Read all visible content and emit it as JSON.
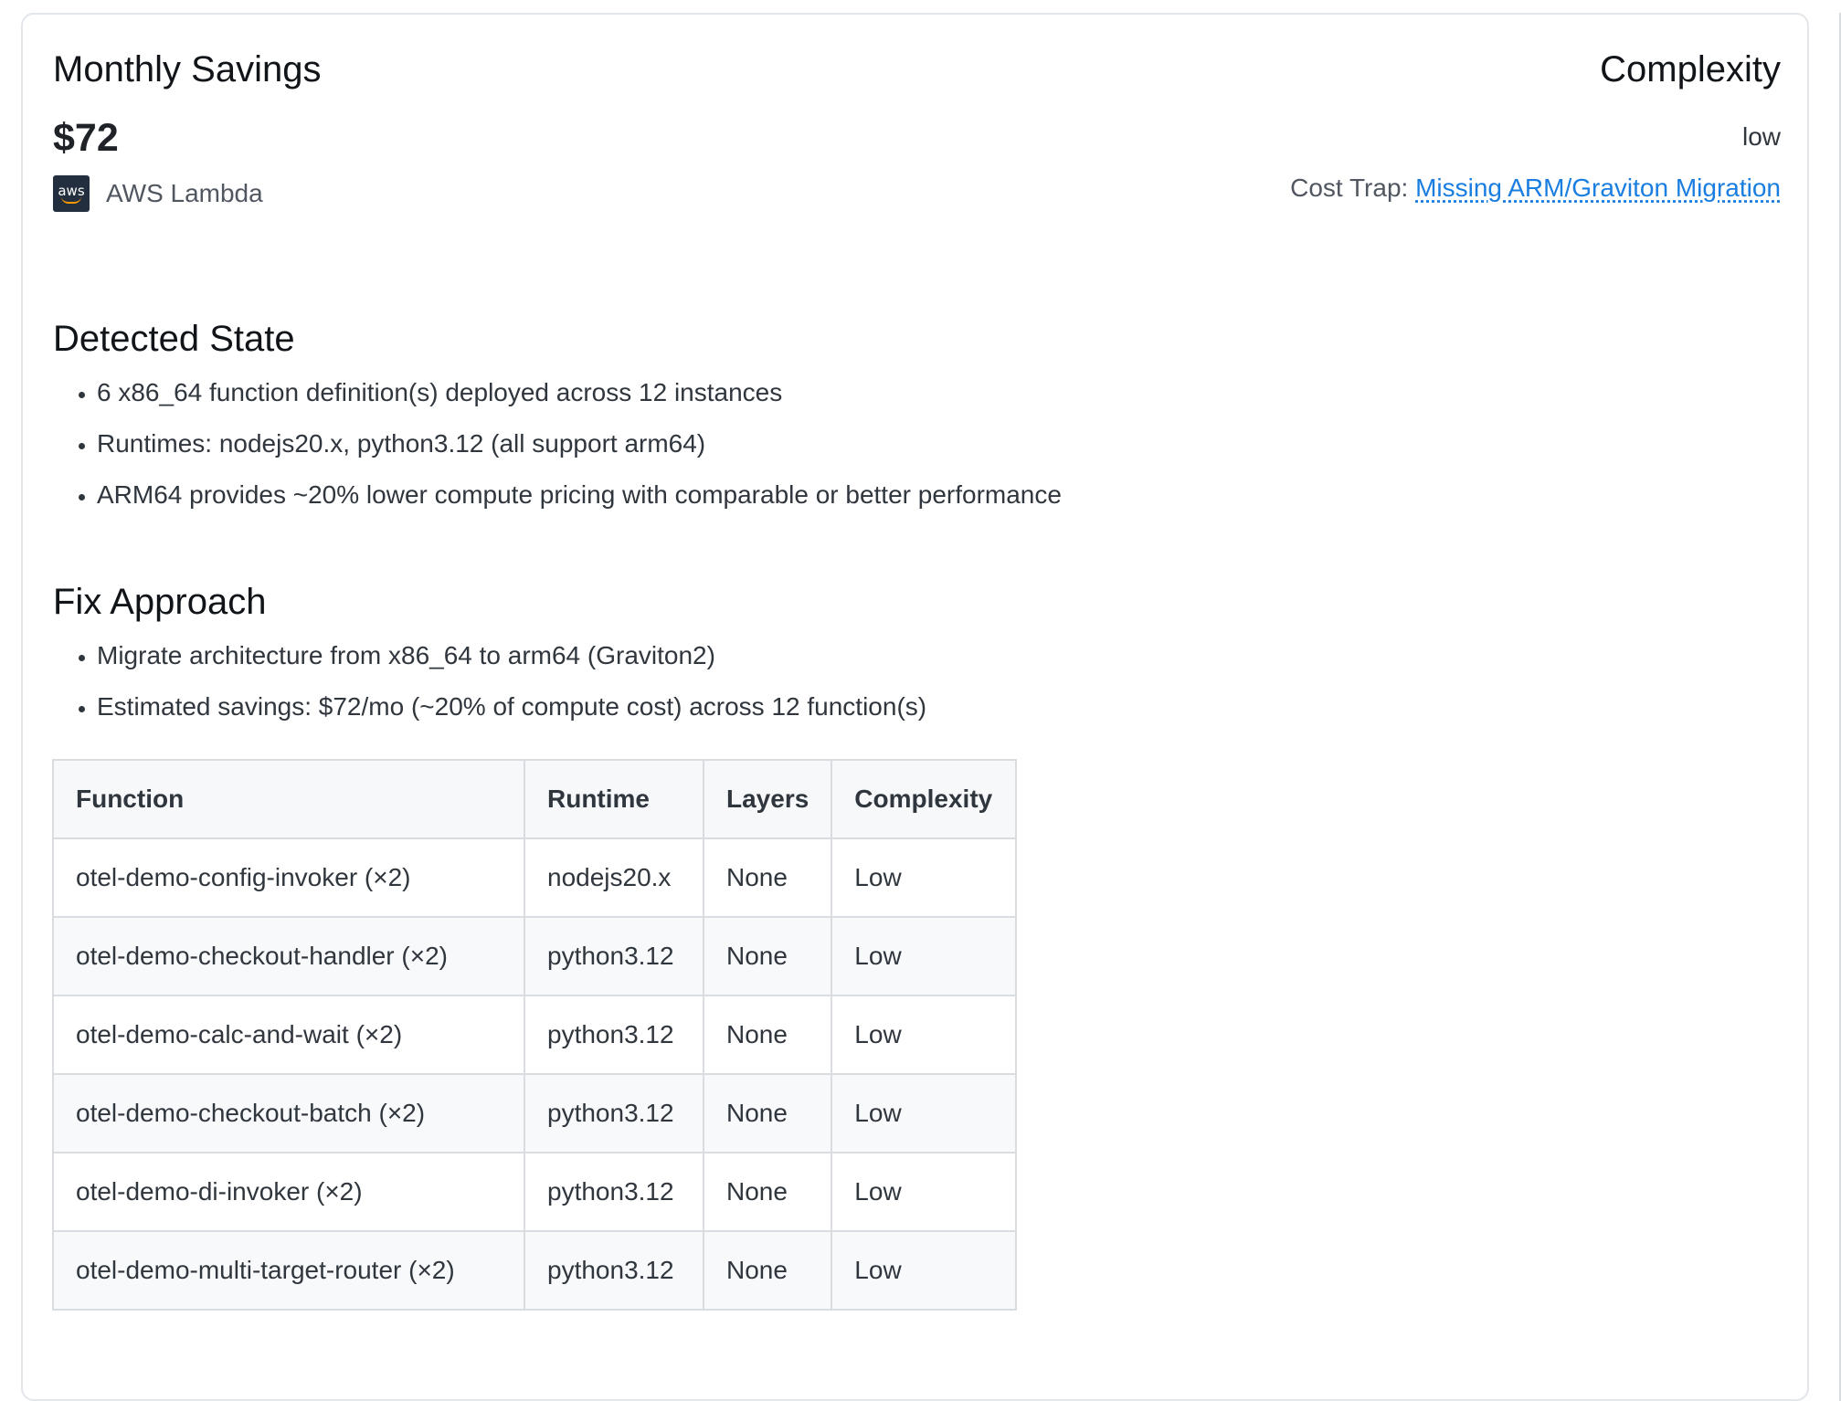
{
  "summary": {
    "savings_label": "Monthly Savings",
    "savings_value": "$72",
    "provider_icon": "aws-logo-icon",
    "provider_icon_text": "aws",
    "provider_name": "AWS Lambda",
    "complexity_label": "Complexity",
    "complexity_value": "low",
    "cost_trap_label": "Cost Trap:",
    "cost_trap_link": "Missing ARM/Graviton Migration"
  },
  "detected_state": {
    "title": "Detected State",
    "items": [
      "6 x86_64 function definition(s) deployed across 12 instances",
      "Runtimes: nodejs20.x, python3.12 (all support arm64)",
      "ARM64 provides ~20% lower compute pricing with comparable or better performance"
    ]
  },
  "fix_approach": {
    "title": "Fix Approach",
    "items": [
      "Migrate architecture from x86_64 to arm64 (Graviton2)",
      "Estimated savings: $72/mo (~20% of compute cost) across 12 function(s)"
    ]
  },
  "table": {
    "headers": [
      "Function",
      "Runtime",
      "Layers",
      "Complexity"
    ],
    "rows": [
      [
        "otel-demo-config-invoker (×2)",
        "nodejs20.x",
        "None",
        "Low"
      ],
      [
        "otel-demo-checkout-handler (×2)",
        "python3.12",
        "None",
        "Low"
      ],
      [
        "otel-demo-calc-and-wait (×2)",
        "python3.12",
        "None",
        "Low"
      ],
      [
        "otel-demo-checkout-batch (×2)",
        "python3.12",
        "None",
        "Low"
      ],
      [
        "otel-demo-di-invoker (×2)",
        "python3.12",
        "None",
        "Low"
      ],
      [
        "otel-demo-multi-target-router (×2)",
        "python3.12",
        "None",
        "Low"
      ]
    ]
  },
  "colors": {
    "link": "#1a7ee0",
    "aws_dark": "#232f3e",
    "aws_orange": "#ff9900",
    "table_border": "#d9dde2",
    "table_header_bg": "#f6f8fa"
  }
}
